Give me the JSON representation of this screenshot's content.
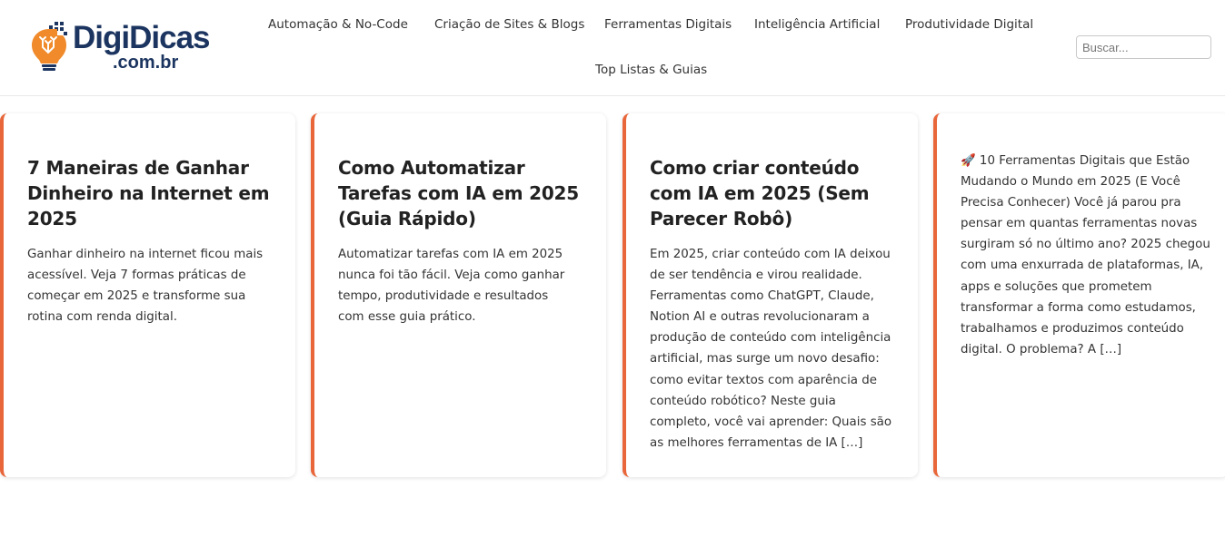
{
  "site": {
    "logo_main": "DigiDicas",
    "logo_sub": ".com.br",
    "brand_colors": {
      "navy": "#1c3560",
      "orange": "#f08a2a",
      "accent": "#e8663a"
    }
  },
  "nav": {
    "items": [
      {
        "label": "Automação & No-Code"
      },
      {
        "label": "Criação de Sites & Blogs"
      },
      {
        "label": "Ferramentas Digitais"
      },
      {
        "label": "Inteligência Artificial"
      },
      {
        "label": "Produtividade Digital"
      },
      {
        "label": "Top Listas & Guias"
      }
    ]
  },
  "search": {
    "placeholder": "Buscar...",
    "value": ""
  },
  "posts": [
    {
      "title": "7 Maneiras de Ganhar Dinheiro na Internet em 2025",
      "excerpt": "Ganhar dinheiro na internet ficou mais acessível. Veja 7 formas práticas de começar em 2025 e transforme sua rotina com renda digital."
    },
    {
      "title": "Como Automatizar Tarefas com IA em 2025 (Guia Rápido)",
      "excerpt": "Automatizar tarefas com IA em 2025 nunca foi tão fácil. Veja como ganhar tempo, produtividade e resultados com esse guia prático."
    },
    {
      "title": "Como criar conteúdo com IA em 2025 (Sem Parecer Robô)",
      "excerpt": "Em 2025, criar conteúdo com IA deixou de ser tendência e virou realidade. Ferramentas como ChatGPT, Claude, Notion AI e outras revolucionaram a produção de conteúdo com inteligência artificial, mas surge um novo desafio: como evitar textos com aparência de conteúdo robótico? Neste guia completo, você vai aprender: Quais são as melhores ferramentas de IA […]"
    },
    {
      "title": "",
      "excerpt": "🚀 10 Ferramentas Digitais que Estão Mudando o Mundo em 2025 (E Você Precisa Conhecer) Você já parou pra pensar em quantas ferramentas novas surgiram só no último ano? 2025 chegou com uma enxurrada de plataformas, IA, apps e soluções que prometem transformar a forma como estudamos, trabalhamos e produzimos conteúdo digital. O problema? A […]"
    }
  ]
}
